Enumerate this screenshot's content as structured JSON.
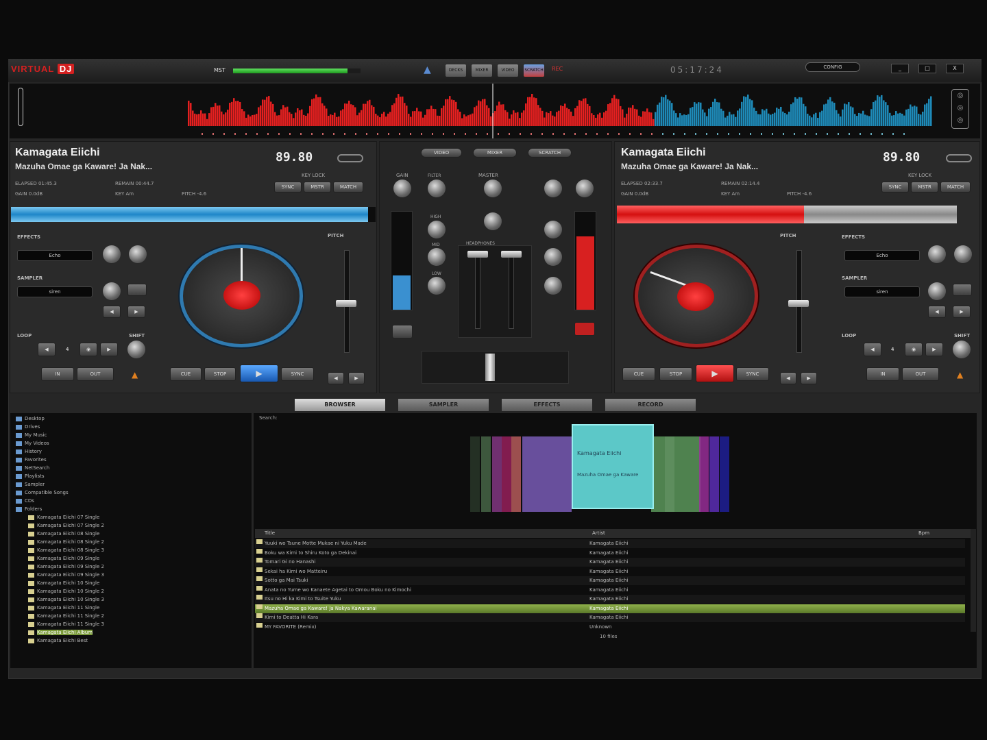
{
  "app": {
    "logo": "VIRTUAL",
    "logo_badge": "DJ",
    "master_label": "MST",
    "master_volume": 0.9,
    "clock": "05:17:24",
    "config": "CONFIG",
    "window_buttons": [
      "_",
      "□",
      "X"
    ],
    "view_buttons": [
      "DECKS",
      "MIXER",
      "VIDEO",
      "SCRATCH",
      "REC"
    ]
  },
  "left_deck": {
    "artist": "Kamagata Eiichi",
    "title": "Mazuha Omae ga Kaware! Ja Nak...",
    "elapsed": "ELAPSED 01:45.3",
    "remain": "REMAIN 00:44.7",
    "gain": "GAIN 0.0dB",
    "key": "KEY Am",
    "pitch": "PITCH -4.6",
    "bpm": "89.80",
    "bpm_label": "KEY LOCK",
    "sync_buttons": [
      "SYNC",
      "MSTR",
      "MATCH"
    ],
    "effects_label": "EFFECTS",
    "effect": "Echo",
    "sampler_label": "SAMPLER",
    "sample": "siren",
    "loop_label": "LOOP",
    "loop_value": "4",
    "shift_label": "SHIFT",
    "pitch_label": "PITCH",
    "transport": [
      "CUE",
      "STOP",
      "PLAY",
      "SYNC"
    ],
    "in_out": [
      "IN",
      "OUT"
    ],
    "progress": 0.98
  },
  "right_deck": {
    "artist": "Kamagata Eiichi",
    "title": "Mazuha Omae ga Kaware! Ja Nak...",
    "elapsed": "ELAPSED 02:33.7",
    "remain": "REMAIN 02:14.4",
    "gain": "GAIN 0.0dB",
    "key": "KEY Am",
    "pitch": "PITCH -4.6",
    "bpm": "89.80",
    "bpm_label": "KEY LOCK",
    "sync_buttons": [
      "SYNC",
      "MSTR",
      "MATCH"
    ],
    "effects_label": "EFFECTS",
    "effect": "Echo",
    "sampler_label": "SAMPLER",
    "sample": "siren",
    "loop_label": "LOOP",
    "loop_value": "4",
    "shift_label": "SHIFT",
    "pitch_label": "PITCH",
    "transport": [
      "CUE",
      "STOP",
      "PLAY",
      "SYNC"
    ],
    "in_out": [
      "IN",
      "OUT"
    ],
    "progress": 0.55
  },
  "mixer": {
    "top_buttons": [
      "VIDEO",
      "MIXER",
      "SCRATCH"
    ],
    "knob_labels": [
      "GAIN",
      "HIGH",
      "MID",
      "LOW",
      "FILTER"
    ],
    "master": "MASTER",
    "headphones": "HEADPHONES",
    "level_left": 0.35,
    "level_right": 0.75
  },
  "browser": {
    "tabs": [
      "BROWSER",
      "SAMPLER",
      "EFFECTS",
      "RECORD"
    ],
    "search_label": "Search:",
    "columns": [
      "Title",
      "Artist",
      "Bpm"
    ],
    "tree": [
      "Desktop",
      "Drives",
      "My Music",
      "My Videos",
      "History",
      "Favorites",
      "NetSearch",
      "Playlists",
      "Sampler",
      "Compatible Songs",
      "CDs",
      "Folders"
    ],
    "folders": [
      "Kamagata Eiichi 07 Single",
      "Kamagata Eiichi 07 Single 2",
      "Kamagata Eiichi 08 Single",
      "Kamagata Eiichi 08 Single 2",
      "Kamagata Eiichi 08 Single 3",
      "Kamagata Eiichi 09 Single",
      "Kamagata Eiichi 09 Single 2",
      "Kamagata Eiichi 09 Single 3",
      "Kamagata Eiichi 10 Single",
      "Kamagata Eiichi 10 Single 2",
      "Kamagata Eiichi 10 Single 3",
      "Kamagata Eiichi 11 Single",
      "Kamagata Eiichi 11 Single 2",
      "Kamagata Eiichi 11 Single 3",
      "Kamagata Eiichi Album",
      "Kamagata Eiichi Best"
    ],
    "selected_folder": 14,
    "coverflow": {
      "artist": "Kamagata Eiichi",
      "title": "Mazuha Omae ga Kaware"
    },
    "tracks": [
      {
        "title": "Yuuki wo Tsune Motte Mukae ni Yuku Made",
        "artist": "Kamagata Eiichi"
      },
      {
        "title": "Boku wa Kimi to Shiru Koto ga Dekinai",
        "artist": "Kamagata Eiichi"
      },
      {
        "title": "Tomari Gi no Hanashi",
        "artist": "Kamagata Eiichi"
      },
      {
        "title": "Sekai ha Kimi wo Matteiru",
        "artist": "Kamagata Eiichi"
      },
      {
        "title": "Sotto ga Mai Tsuki",
        "artist": "Kamagata Eiichi"
      },
      {
        "title": "Anata no Yume wo Kanaete Agetai to Omou Boku no Kimochi",
        "artist": "Kamagata Eiichi"
      },
      {
        "title": "Itsu no Hi ka Kimi to Tsuite Yuku",
        "artist": "Kamagata Eiichi"
      },
      {
        "title": "Mazuha Omae ga Kaware! Ja Nakya Kawaranai",
        "artist": "Kamagata Eiichi"
      },
      {
        "title": "Kimi to Deatta Hi Kara",
        "artist": "Kamagata Eiichi"
      },
      {
        "title": "MY FAVORITE (Remix)",
        "artist": "Unknown"
      }
    ],
    "selected_track": 7,
    "status": "10 files"
  }
}
